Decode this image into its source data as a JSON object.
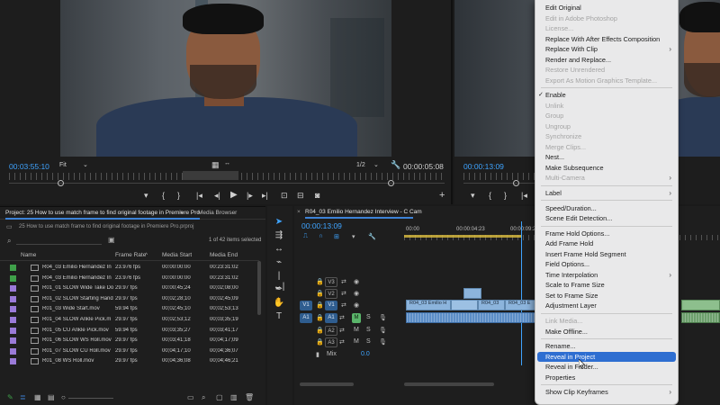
{
  "source_monitor": {
    "timecode_current": "00:03:55:10",
    "fit": "Fit",
    "resolution": "1/2",
    "timecode_duration": "00:00:05:08"
  },
  "program_monitor": {
    "timecode_current": "00:00:13:09"
  },
  "project_panel": {
    "tab_project": "Project: 25 How to use match frame to find original footage in Premiere Pro",
    "tab_media_browser": "Media Browser",
    "path": "25 How to use match frame to find original footage in Premiere Pro.prproj",
    "item_count": "1 of 42 items selected",
    "columns": [
      "Name",
      "Frame Rate",
      "Media Start",
      "Media End"
    ],
    "rows": [
      {
        "color": "#3fa04a",
        "name": "R04_03 Emilio Hernandez In",
        "fps": "23.976 fps",
        "start": "00:00:00:00",
        "end": "00:23:31:02"
      },
      {
        "color": "#3fa04a",
        "name": "R04_03 Emilio Hernandez In",
        "fps": "23.976 fps",
        "start": "00:00:00:00",
        "end": "00:23:31:02"
      },
      {
        "color": "#9a7ad8",
        "name": "R01_01 SLOW Wide Take Do",
        "fps": "29.97 fps",
        "start": "00:00;45;24",
        "end": "00;02;08;00"
      },
      {
        "color": "#9a7ad8",
        "name": "R01_02 SLOW Starting Hand",
        "fps": "29.97 fps",
        "start": "00;02;28;10",
        "end": "00;02;45;09"
      },
      {
        "color": "#9a7ad8",
        "name": "R01_03 Wide Start.mov",
        "fps": "59.94 fps",
        "start": "00;02;45;10",
        "end": "00;02;53;13"
      },
      {
        "color": "#9a7ad8",
        "name": "R01_04 SLOW Ankle Pick.m",
        "fps": "29.97 fps",
        "start": "00;02;53;12",
        "end": "00;03;35;19"
      },
      {
        "color": "#9a7ad8",
        "name": "R01_05 CU Ankle Pick.mov",
        "fps": "59.94 fps",
        "start": "00;03;35;27",
        "end": "00;03;41;17"
      },
      {
        "color": "#9a7ad8",
        "name": "R01_06 SLOW WS Roll.mov",
        "fps": "29.97 fps",
        "start": "00;03;41;18",
        "end": "00;04;17;09"
      },
      {
        "color": "#9a7ad8",
        "name": "R01_07 SLOW CU Roll.mov",
        "fps": "29.97 fps",
        "start": "00;04;17;10",
        "end": "00;04;36;07"
      },
      {
        "color": "#9a7ad8",
        "name": "R01_08 WS Roll.mov",
        "fps": "29.97 fps",
        "start": "00;04;36;08",
        "end": "00;04;46;21"
      }
    ]
  },
  "timeline": {
    "tab": "R04_03 Emilio Hernandez Interview - C Cam",
    "timecode": "00:00:13:09",
    "ruler": [
      "00:00",
      "00:00:04:23",
      "00:00:09:23"
    ],
    "video_tracks": [
      "V3",
      "V2",
      "V1"
    ],
    "audio_tracks": [
      "A1",
      "A2",
      "A3"
    ],
    "source_patch_v": "V1",
    "source_patch_a": "A1",
    "mix_label": "Mix",
    "mix_value": "0.0",
    "clip_labels": [
      "R04_03 Emilio H",
      "R04_03",
      "R04_03 E"
    ]
  },
  "context_menu": {
    "items": [
      {
        "label": "Edit Original",
        "enabled": true
      },
      {
        "label": "Edit in Adobe Photoshop",
        "enabled": false
      },
      {
        "label": "License...",
        "enabled": false
      },
      {
        "label": "Replace With After Effects Composition",
        "enabled": true
      },
      {
        "label": "Replace With Clip",
        "enabled": true,
        "submenu": true
      },
      {
        "label": "Render and Replace...",
        "enabled": true
      },
      {
        "label": "Restore Unrendered",
        "enabled": false
      },
      {
        "label": "Export As Motion Graphics Template...",
        "enabled": false
      },
      {
        "label": "Enable",
        "enabled": true,
        "checked": true
      },
      {
        "label": "Unlink",
        "enabled": false
      },
      {
        "label": "Group",
        "enabled": false
      },
      {
        "label": "Ungroup",
        "enabled": false
      },
      {
        "label": "Synchronize",
        "enabled": false
      },
      {
        "label": "Merge Clips...",
        "enabled": false
      },
      {
        "label": "Nest...",
        "enabled": true
      },
      {
        "label": "Make Subsequence",
        "enabled": true
      },
      {
        "label": "Multi-Camera",
        "enabled": false,
        "submenu": true
      },
      {
        "label": "Label",
        "enabled": true,
        "submenu": true
      },
      {
        "label": "Speed/Duration...",
        "enabled": true
      },
      {
        "label": "Scene Edit Detection...",
        "enabled": true
      },
      {
        "label": "Frame Hold Options...",
        "enabled": true
      },
      {
        "label": "Add Frame Hold",
        "enabled": true
      },
      {
        "label": "Insert Frame Hold Segment",
        "enabled": true
      },
      {
        "label": "Field Options...",
        "enabled": true
      },
      {
        "label": "Time Interpolation",
        "enabled": true,
        "submenu": true
      },
      {
        "label": "Scale to Frame Size",
        "enabled": true
      },
      {
        "label": "Set to Frame Size",
        "enabled": true
      },
      {
        "label": "Adjustment Layer",
        "enabled": true
      },
      {
        "label": "Link Media...",
        "enabled": false
      },
      {
        "label": "Make Offline...",
        "enabled": true
      },
      {
        "label": "Rename...",
        "enabled": true
      },
      {
        "label": "Reveal in Project",
        "enabled": true,
        "highlighted": true
      },
      {
        "label": "Reveal in Finder...",
        "enabled": true
      },
      {
        "label": "Properties",
        "enabled": true
      },
      {
        "label": "Show Clip Keyframes",
        "enabled": true,
        "submenu": true
      }
    ]
  },
  "colors": {
    "accent_blue": "#3fa4ff",
    "menu_highlight": "#2e6ed1",
    "track_target": "#2f5d8f",
    "video_clip": "#8cb4dc",
    "audio_clip": "#5c8ec7"
  }
}
